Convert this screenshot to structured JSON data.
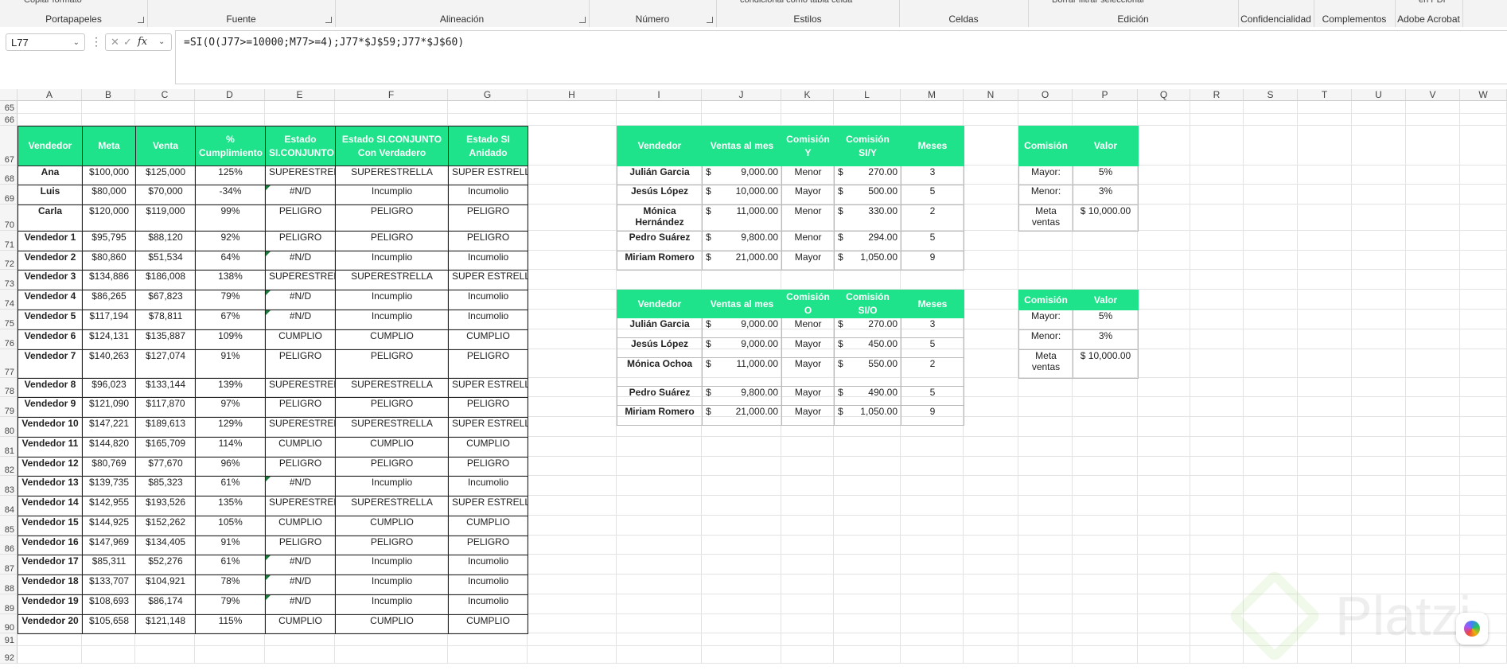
{
  "ribbon": {
    "groups": [
      {
        "label": "Portapapeles",
        "tip": "Copiar formato"
      },
      {
        "label": "Fuente"
      },
      {
        "label": "Alineación"
      },
      {
        "label": "Número"
      },
      {
        "label": "Estilos",
        "tip": "condicional   como tabla   celda"
      },
      {
        "label": "Celdas"
      },
      {
        "label": "Edición",
        "tip": "Borrar   filtrar   seleccionar"
      },
      {
        "label": "Confidencialidad"
      },
      {
        "label": "Complementos"
      },
      {
        "label": "Adobe Acrobat",
        "tip": "en PDF"
      }
    ]
  },
  "formula_bar": {
    "name_box": "L77",
    "fx": "fx",
    "formula": "=SI(O(J77>=10000;M77>=4);J77*$J$59;J77*$J$60)"
  },
  "columns": [
    "A",
    "B",
    "C",
    "D",
    "E",
    "F",
    "G",
    "H",
    "I",
    "J",
    "K",
    "L",
    "M",
    "N",
    "O",
    "P",
    "Q",
    "R",
    "S",
    "T",
    "U",
    "V",
    "W"
  ],
  "rows": [
    "65",
    "66",
    "67",
    "68",
    "69",
    "70",
    "71",
    "72",
    "73",
    "74",
    "75",
    "76",
    "77",
    "78",
    "79",
    "80",
    "81",
    "82",
    "83",
    "84",
    "85",
    "86",
    "87",
    "88",
    "89",
    "90",
    "91",
    "92"
  ],
  "table1": {
    "headers": [
      "Vendedor",
      "Meta",
      "Venta",
      "% Cumplimiento",
      "Estado SI.CONJUNTO",
      "Estado SI.CONJUNTO Con Verdadero",
      "Estado SI Anidado"
    ],
    "rows": [
      [
        "Ana",
        "$100,000",
        "$125,000",
        "125%",
        "SUPERESTREL",
        "SUPERESTRELLA",
        "SUPER ESTRELLA"
      ],
      [
        "Luis",
        "$80,000",
        "$70,000",
        "-34%",
        "#N/D",
        "Incumplio",
        "Incumolio"
      ],
      [
        "Carla",
        "$120,000",
        "$119,000",
        "99%",
        "PELIGRO",
        "PELIGRO",
        "PELIGRO"
      ],
      [
        "Vendedor 1",
        "$95,795",
        "$88,120",
        "92%",
        "PELIGRO",
        "PELIGRO",
        "PELIGRO"
      ],
      [
        "Vendedor 2",
        "$80,860",
        "$51,534",
        "64%",
        "#N/D",
        "Incumplio",
        "Incumolio"
      ],
      [
        "Vendedor 3",
        "$134,886",
        "$186,008",
        "138%",
        "SUPERESTREL",
        "SUPERESTRELLA",
        "SUPER ESTRELLA"
      ],
      [
        "Vendedor 4",
        "$86,265",
        "$67,823",
        "79%",
        "#N/D",
        "Incumplio",
        "Incumolio"
      ],
      [
        "Vendedor 5",
        "$117,194",
        "$78,811",
        "67%",
        "#N/D",
        "Incumplio",
        "Incumolio"
      ],
      [
        "Vendedor 6",
        "$124,131",
        "$135,887",
        "109%",
        "CUMPLIO",
        "CUMPLIO",
        "CUMPLIO"
      ],
      [
        "Vendedor 7",
        "$140,263",
        "$127,074",
        "91%",
        "PELIGRO",
        "PELIGRO",
        "PELIGRO"
      ],
      [
        "Vendedor 8",
        "$96,023",
        "$133,144",
        "139%",
        "SUPERESTREL",
        "SUPERESTRELLA",
        "SUPER ESTRELLA"
      ],
      [
        "Vendedor 9",
        "$121,090",
        "$117,870",
        "97%",
        "PELIGRO",
        "PELIGRO",
        "PELIGRO"
      ],
      [
        "Vendedor 10",
        "$147,221",
        "$189,613",
        "129%",
        "SUPERESTREL",
        "SUPERESTRELLA",
        "SUPER ESTRELLA"
      ],
      [
        "Vendedor 11",
        "$144,820",
        "$165,709",
        "114%",
        "CUMPLIO",
        "CUMPLIO",
        "CUMPLIO"
      ],
      [
        "Vendedor 12",
        "$80,769",
        "$77,670",
        "96%",
        "PELIGRO",
        "PELIGRO",
        "PELIGRO"
      ],
      [
        "Vendedor 13",
        "$139,735",
        "$85,323",
        "61%",
        "#N/D",
        "Incumplio",
        "Incumolio"
      ],
      [
        "Vendedor 14",
        "$142,955",
        "$193,526",
        "135%",
        "SUPERESTREL",
        "SUPERESTRELLA",
        "SUPER ESTRELLA"
      ],
      [
        "Vendedor 15",
        "$144,925",
        "$152,262",
        "105%",
        "CUMPLIO",
        "CUMPLIO",
        "CUMPLIO"
      ],
      [
        "Vendedor 16",
        "$147,969",
        "$134,405",
        "91%",
        "PELIGRO",
        "PELIGRO",
        "PELIGRO"
      ],
      [
        "Vendedor 17",
        "$85,311",
        "$52,276",
        "61%",
        "#N/D",
        "Incumplio",
        "Incumolio"
      ],
      [
        "Vendedor 18",
        "$133,707",
        "$104,921",
        "78%",
        "#N/D",
        "Incumplio",
        "Incumolio"
      ],
      [
        "Vendedor 19",
        "$108,693",
        "$86,174",
        "79%",
        "#N/D",
        "Incumplio",
        "Incumolio"
      ],
      [
        "Vendedor 20",
        "$105,658",
        "$121,148",
        "115%",
        "CUMPLIO",
        "CUMPLIO",
        "CUMPLIO"
      ]
    ]
  },
  "table2": {
    "headers": [
      "Vendedor",
      "Ventas al mes",
      "Comisión Y",
      "Comisión SI/Y",
      "Meses"
    ],
    "rows": [
      [
        "Julián Garcia",
        "9,000.00",
        "Menor",
        "270.00",
        "3"
      ],
      [
        "Jesús López",
        "10,000.00",
        "Mayor",
        "500.00",
        "5"
      ],
      [
        "Mónica Hernández",
        "11,000.00",
        "Menor",
        "330.00",
        "2"
      ],
      [
        "Pedro Suárez",
        "9,800.00",
        "Menor",
        "294.00",
        "5"
      ],
      [
        "Miriam Romero",
        "21,000.00",
        "Mayor",
        "1,050.00",
        "9"
      ]
    ]
  },
  "table3": {
    "headers": [
      "Vendedor",
      "Ventas al mes",
      "Comisión O",
      "Comisión SI/O",
      "Meses"
    ],
    "rows": [
      [
        "Julián Garcia",
        "9,000.00",
        "Menor",
        "270.00",
        "3"
      ],
      [
        "Jesús López",
        "9,000.00",
        "Mayor",
        "450.00",
        "5"
      ],
      [
        "Mónica Ochoa",
        "11,000.00",
        "Mayor",
        "550.00",
        "2"
      ],
      [
        "Pedro Suárez",
        "9,800.00",
        "Mayor",
        "490.00",
        "5"
      ],
      [
        "Miriam Romero",
        "21,000.00",
        "Mayor",
        "1,050.00",
        "9"
      ]
    ]
  },
  "table4": {
    "headers": [
      "Comisión",
      "Valor"
    ],
    "rows": [
      [
        "Mayor:",
        "5%"
      ],
      [
        "Menor:",
        "3%"
      ],
      [
        "Meta ventas",
        "$ 10,000.00"
      ]
    ]
  },
  "table5": {
    "headers": [
      "Comisión",
      "Valor"
    ],
    "rows": [
      [
        "Mayor:",
        "5%"
      ],
      [
        "Menor:",
        "3%"
      ],
      [
        "Meta ventas",
        "$ 10,000.00"
      ]
    ]
  },
  "currency_symbol": "$",
  "watermark": "Platzi",
  "colors": {
    "header_green": "#1ee38a",
    "grid": "#e3e3e3"
  }
}
